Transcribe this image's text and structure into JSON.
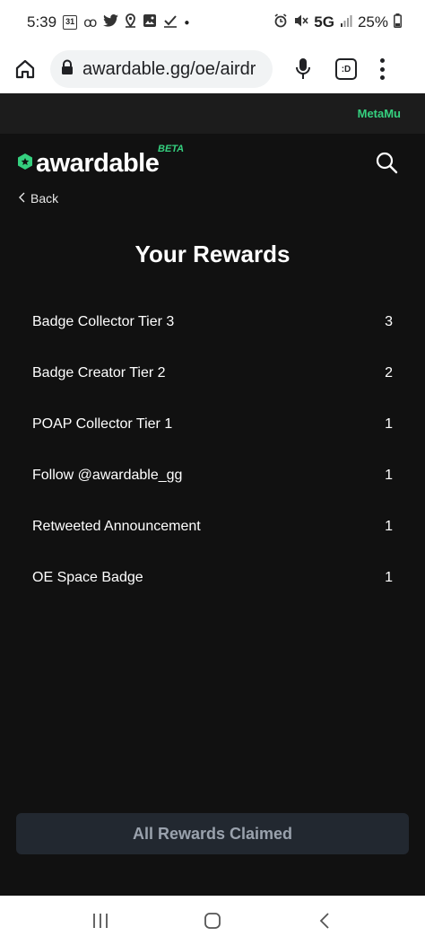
{
  "status_bar": {
    "time": "5:39",
    "calendar_day": "31",
    "network": "5G",
    "battery": "25%",
    "icons": [
      "calendar-icon",
      "voicemail-icon",
      "twitter-icon",
      "location-icon",
      "image-icon",
      "check-icon",
      "dot-icon",
      "alarm-icon",
      "mute-icon",
      "signal-icon",
      "battery-icon"
    ]
  },
  "browser": {
    "url": "awardable.gg/oe/airdr",
    "tabs_label": ":D"
  },
  "site": {
    "username": "MetaMu",
    "logo_text": "awardable",
    "beta_label": "BETA",
    "back_label": "Back",
    "accent_color": "#35d07f"
  },
  "page": {
    "title": "Your Rewards",
    "rewards": [
      {
        "name": "Badge Collector Tier 3",
        "count": "3"
      },
      {
        "name": "Badge Creator Tier 2",
        "count": "2"
      },
      {
        "name": "POAP Collector Tier 1",
        "count": "1"
      },
      {
        "name": "Follow @awardable_gg",
        "count": "1"
      },
      {
        "name": "Retweeted Announcement",
        "count": "1"
      },
      {
        "name": "OE Space Badge",
        "count": "1"
      }
    ],
    "claim_button": "All Rewards Claimed"
  }
}
